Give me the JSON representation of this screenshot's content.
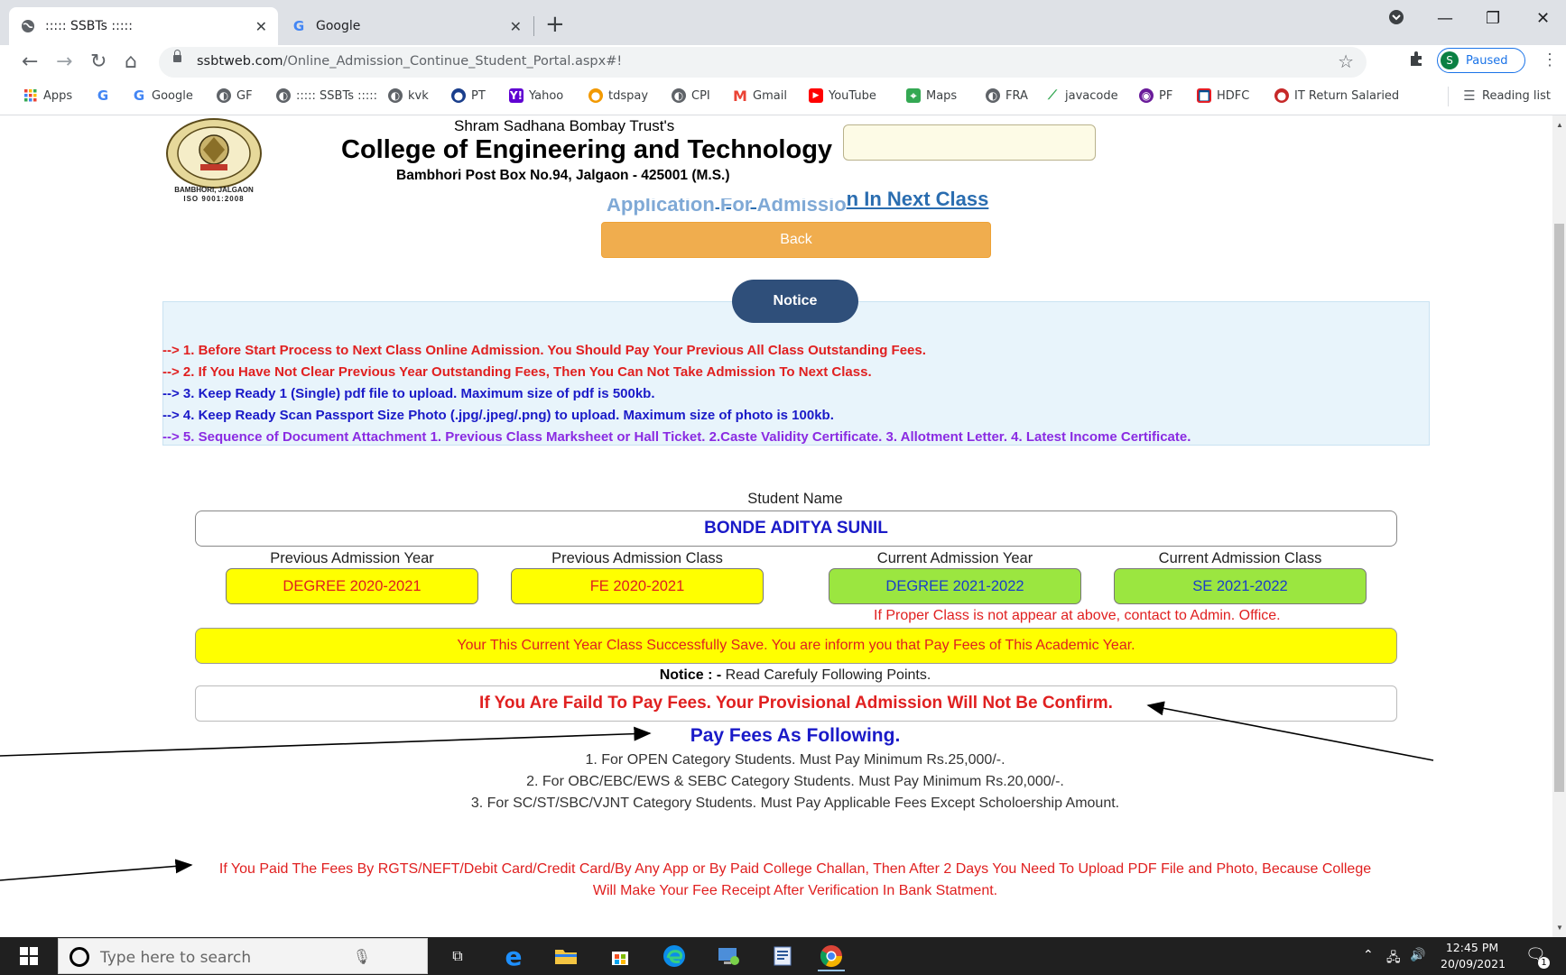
{
  "browser": {
    "tabs": [
      {
        "title": "::::: SSBTs :::::",
        "active": true
      },
      {
        "title": "Google",
        "active": false
      }
    ],
    "url_host": "ssbtweb.com",
    "url_path": "/Online_Admission_Continue_Student_Portal.aspx#!",
    "profile_initial": "S",
    "profile_status": "Paused",
    "bookmarks": [
      "Apps",
      "",
      "Google",
      "GF",
      "::::: SSBTs :::::",
      "kvk",
      "PT",
      "Yahoo",
      "tdspay",
      "CPI",
      "Gmail",
      "YouTube",
      "Maps",
      "FRA",
      "javacode",
      "PF",
      "HDFC",
      "IT Return Salaried"
    ],
    "reading_list": "Reading list"
  },
  "header": {
    "trust": "Shram Sadhana Bombay Trust's",
    "college": "College of Engineering and Technology",
    "address": "Bambhori Post Box No.94, Jalgaon - 425001 (M.S.)",
    "logo_text": "BAMBHORI, JALGAON",
    "logo_iso": "ISO 9001:2008",
    "app_link_hidden": "Application For Admissio",
    "app_link_visible": "n In Next Class",
    "back_label": "Back"
  },
  "notice": {
    "title": "Notice",
    "lines": [
      {
        "text": "--> 1. Before Start Process to Next Class Online Admission. You Should Pay Your Previous All Class Outstanding Fees.",
        "color": "#e02020"
      },
      {
        "text": "--> 2. If You Have Not Clear Previous Year Outstanding Fees, Then You Can Not Take Admission To Next Class.",
        "color": "#e02020"
      },
      {
        "text": "--> 3. Keep Ready 1 (Single) pdf file to upload. Maximum size of pdf is 500kb.",
        "color": "#1a1ac8"
      },
      {
        "text": "--> 4. Keep Ready Scan Passport Size Photo (.jpg/.jpeg/.png) to upload. Maximum size of photo is 100kb.",
        "color": "#1a1ac8"
      },
      {
        "text": "--> 5. Sequence of Document Attachment 1. Previous Class Marksheet or Hall Ticket. 2.Caste Validity Certificate. 3. Allotment Letter. 4. Latest Income Certificate.",
        "color": "#8a2be2"
      }
    ]
  },
  "student": {
    "name_label": "Student Name",
    "name": "BONDE ADITYA SUNIL",
    "prev_year_label": "Previous Admission Year",
    "prev_year": "DEGREE 2020-2021",
    "prev_class_label": "Previous Admission Class",
    "prev_class": "FE 2020-2021",
    "curr_year_label": "Current Admission Year",
    "curr_year": "DEGREE 2021-2022",
    "curr_class_label": "Current Admission Class",
    "curr_class": "SE 2021-2022",
    "class_warning": "If Proper Class is not appear at above, contact to Admin. Office.",
    "success_msg": "Your This Current Year Class Successfully Save. You are inform you that Pay Fees of This Academic Year.",
    "notice_label": "Notice : -",
    "notice_text": " Read Carefuly Following Points.",
    "fail_msg": "If You Are Faild To Pay Fees. Your Provisional Admission Will Not Be Confirm."
  },
  "fees": {
    "heading": "Pay Fees As Following.",
    "lines": [
      "1. For OPEN Category Students. Must Pay Minimum Rs.25,000/-.",
      "2. For OBC/EBC/EWS & SEBC Category Students. Must Pay Minimum Rs.20,000/-.",
      "3. For SC/ST/SBC/VJNT Category Students. Must Pay Applicable Fees Except Scholoership Amount."
    ],
    "paid_note": "If You Paid The Fees By RGTS/NEFT/Debit Card/Credit Card/By Any App or By Paid College Challan, Then After 2 Days You Need To Upload PDF File and Photo, Because College Will Make Your Fee Receipt After Verification In Bank Statment."
  },
  "taskbar": {
    "search_placeholder": "Type here to search",
    "time": "12:45 PM",
    "date": "20/09/2021",
    "notif_count": "1"
  }
}
